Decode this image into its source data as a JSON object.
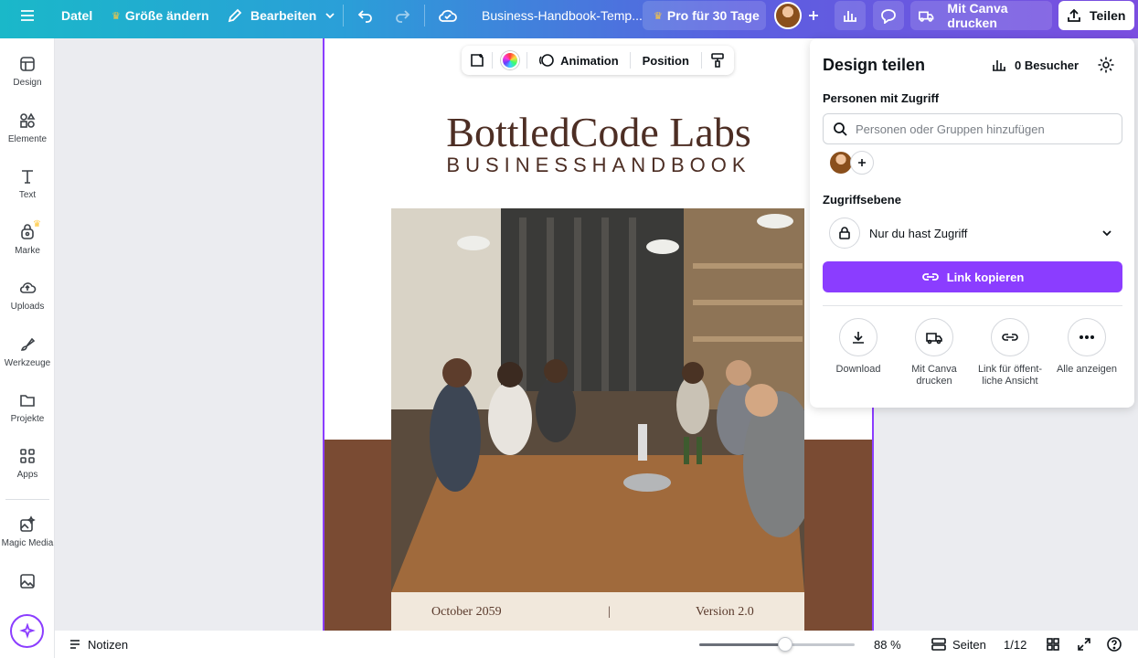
{
  "topbar": {
    "file_label": "Datel",
    "resize_label": "Größe ändern",
    "edit_label": "Bearbeiten",
    "doc_title": "Business-Handbook-Temp...",
    "pro_label": "Pro für 30 Tage",
    "print_label": "Mit Canva drucken",
    "share_label": "Teilen"
  },
  "sidebar": {
    "items": [
      {
        "label": "Design",
        "icon": "design-icon"
      },
      {
        "label": "Elemente",
        "icon": "elements-icon"
      },
      {
        "label": "Text",
        "icon": "text-icon"
      },
      {
        "label": "Marke",
        "icon": "brand-icon"
      },
      {
        "label": "Uploads",
        "icon": "upload-icon"
      },
      {
        "label": "Werkzeuge",
        "icon": "tools-icon"
      },
      {
        "label": "Projekte",
        "icon": "folder-icon"
      },
      {
        "label": "Apps",
        "icon": "apps-icon"
      },
      {
        "label": "Magic Media",
        "icon": "magic-media-icon"
      }
    ]
  },
  "toolbar": {
    "animation_label": "Animation",
    "position_label": "Position"
  },
  "page": {
    "brand": "BottledCode Labs",
    "subtitle": "BUSINESSHANDBOOK",
    "date": "October 2059",
    "divider": "|",
    "version": "Version 2.0"
  },
  "share_panel": {
    "title": "Design teilen",
    "visitors": "0 Besucher",
    "people_label": "Personen mit Zugriff",
    "search_placeholder": "Personen oder Gruppen hinzufügen",
    "access_label": "Zugriffsebene",
    "access_value": "Nur du hast Zugriff",
    "copy_link": "Link kopieren",
    "actions": [
      {
        "label": "Download",
        "icon": "download-icon"
      },
      {
        "label": "Mit Canva drucken",
        "icon": "truck-icon"
      },
      {
        "label": "Link für öffent-liche Ansicht",
        "icon": "link-icon"
      },
      {
        "label": "Alle anzeigen",
        "icon": "more-icon"
      }
    ]
  },
  "bottombar": {
    "notes_label": "Notizen",
    "zoom": "88 %",
    "zoom_level": 0.55,
    "pages_label": "Seiten",
    "page_count": "1/12"
  },
  "colors": {
    "accent": "#8b3dff",
    "brand_brown": "#7a4b33",
    "brand_text": "#4d2e24"
  }
}
